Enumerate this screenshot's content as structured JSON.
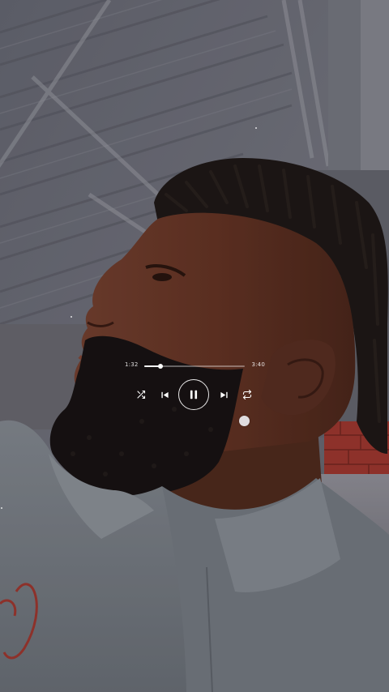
{
  "player": {
    "elapsed": "1:32",
    "total": "3:40",
    "progress": 0.16,
    "state": "playing",
    "controls": {
      "shuffle_icon": "shuffle-icon",
      "previous_icon": "skip-previous-icon",
      "play_pause_icon": "pause-icon",
      "next_icon": "skip-next-icon",
      "repeat_icon": "repeat-icon"
    }
  },
  "colors": {
    "controls": "#ffffff",
    "brick_accent": "#a8392f",
    "shirt": "#7e868e",
    "skin": "#6b3a28"
  }
}
